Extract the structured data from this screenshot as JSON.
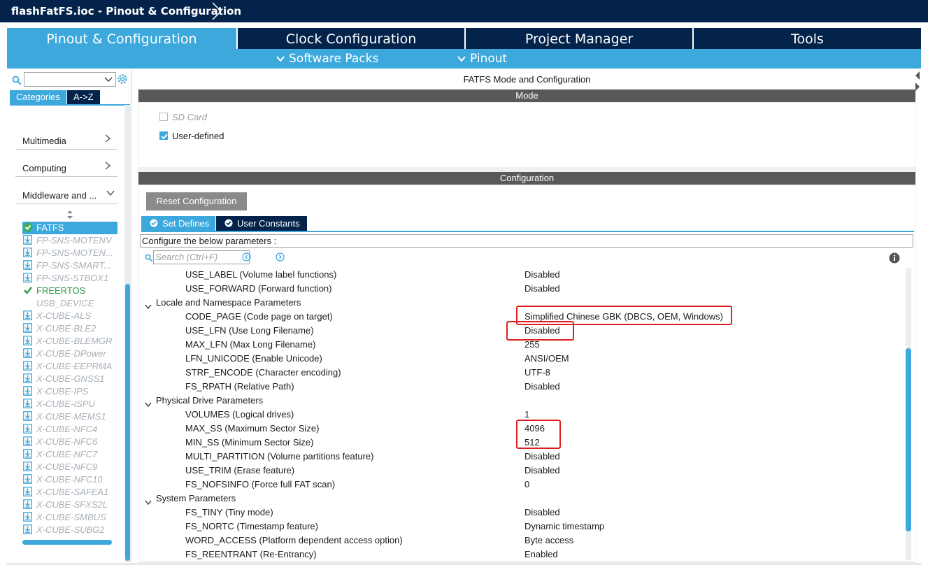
{
  "window": {
    "title": "flashFatFS.ioc - Pinout & Configuration"
  },
  "tabs": [
    {
      "label": "Pinout & Configuration",
      "active": true
    },
    {
      "label": "Clock Configuration"
    },
    {
      "label": "Project Manager"
    },
    {
      "label": "Tools"
    }
  ],
  "subnav": {
    "software_packs": "Software Packs",
    "pinout": "Pinout"
  },
  "left_panel": {
    "view_tabs": {
      "categories": "Categories",
      "az": "A->Z"
    },
    "menu": [
      {
        "label": "Multimedia",
        "chevron": "right"
      },
      {
        "label": "Computing",
        "chevron": "right"
      },
      {
        "label": "Middleware and ...",
        "chevron": "down"
      }
    ],
    "items": [
      {
        "label": "FATFS",
        "state": "selected-ok"
      },
      {
        "label": "FP-SNS-MOTENV",
        "state": "download"
      },
      {
        "label": "FP-SNS-MOTEN...",
        "state": "download"
      },
      {
        "label": "FP-SNS-SMART...",
        "state": "download"
      },
      {
        "label": "FP-SNS-STBOX1",
        "state": "download"
      },
      {
        "label": "FREERTOS",
        "state": "ok"
      },
      {
        "label": "USB_DEVICE",
        "state": "disabled"
      },
      {
        "label": "X-CUBE-ALS",
        "state": "download"
      },
      {
        "label": "X-CUBE-BLE2",
        "state": "download"
      },
      {
        "label": "X-CUBE-BLEMGR",
        "state": "download"
      },
      {
        "label": "X-CUBE-DPower",
        "state": "download"
      },
      {
        "label": "X-CUBE-EEPRMA",
        "state": "download"
      },
      {
        "label": "X-CUBE-GNSS1",
        "state": "download"
      },
      {
        "label": "X-CUBE-IPS",
        "state": "download"
      },
      {
        "label": "X-CUBE-ISPU",
        "state": "download"
      },
      {
        "label": "X-CUBE-MEMS1",
        "state": "download"
      },
      {
        "label": "X-CUBE-NFC4",
        "state": "download"
      },
      {
        "label": "X-CUBE-NFC6",
        "state": "download"
      },
      {
        "label": "X-CUBE-NFC7",
        "state": "download"
      },
      {
        "label": "X-CUBE-NFC9",
        "state": "download"
      },
      {
        "label": "X-CUBE-NFC10",
        "state": "download"
      },
      {
        "label": "X-CUBE-SAFEA1",
        "state": "download"
      },
      {
        "label": "X-CUBE-SFXS2L",
        "state": "download"
      },
      {
        "label": "X-CUBE-SMBUS",
        "state": "download"
      },
      {
        "label": "X-CUBE-SUBG2",
        "state": "download"
      }
    ]
  },
  "main": {
    "header": "FATFS Mode and Configuration",
    "mode_bar": "Mode",
    "mode_options": [
      {
        "label": "SD Card",
        "checked": false,
        "enabled": false
      },
      {
        "label": "User-defined",
        "checked": true,
        "enabled": true
      }
    ],
    "config_bar": "Configuration",
    "reset_button": "Reset Configuration",
    "subtabs": {
      "set_defines": "Set Defines",
      "user_constants": "User Constants"
    },
    "config_message": "Configure the below parameters :",
    "search_placeholder": "Search (Ctrl+F)",
    "params": [
      {
        "name": "USE_LABEL (Volume label functions)",
        "value": "Disabled"
      },
      {
        "name": "USE_FORWARD (Forward function)",
        "value": "Disabled"
      },
      {
        "group": "Locale and Namespace Parameters"
      },
      {
        "name": "CODE_PAGE (Code page on target)",
        "value": "Simplified Chinese GBK (DBCS, OEM, Windows)"
      },
      {
        "name": "USE_LFN (Use Long Filename)",
        "value": "Disabled"
      },
      {
        "name": "MAX_LFN (Max Long Filename)",
        "value": "255"
      },
      {
        "name": "LFN_UNICODE (Enable Unicode)",
        "value": "ANSI/OEM"
      },
      {
        "name": "STRF_ENCODE (Character encoding)",
        "value": "UTF-8"
      },
      {
        "name": "FS_RPATH (Relative Path)",
        "value": "Disabled"
      },
      {
        "group": "Physical Drive Parameters"
      },
      {
        "name": "VOLUMES (Logical drives)",
        "value": "1"
      },
      {
        "name": "MAX_SS (Maximum Sector Size)",
        "value": "4096"
      },
      {
        "name": "MIN_SS (Minimum Sector Size)",
        "value": "512"
      },
      {
        "name": "MULTI_PARTITION (Volume partitions feature)",
        "value": "Disabled"
      },
      {
        "name": "USE_TRIM (Erase feature)",
        "value": "Disabled"
      },
      {
        "name": "FS_NOFSINFO (Force full FAT scan)",
        "value": "0"
      },
      {
        "group": "System Parameters"
      },
      {
        "name": "FS_TINY (Tiny mode)",
        "value": "Disabled"
      },
      {
        "name": "FS_NORTC (Timestamp feature)",
        "value": "Dynamic timestamp"
      },
      {
        "name": "WORD_ACCESS (Platform dependent access option)",
        "value": "Byte access"
      },
      {
        "name": "FS_REENTRANT (Re-Entrancy)",
        "value": "Enabled"
      }
    ]
  },
  "colors": {
    "navy": "#03234b",
    "accent": "#3ca8dc",
    "bar": "#595959",
    "ok_green": "#2d9e46",
    "highlight_red": "#e02020"
  },
  "icons": [
    "chevron-right-icon",
    "search-icon",
    "gear-icon",
    "check-circle-icon",
    "download-icon",
    "info-icon",
    "nav-left-icon",
    "nav-right-icon"
  ]
}
